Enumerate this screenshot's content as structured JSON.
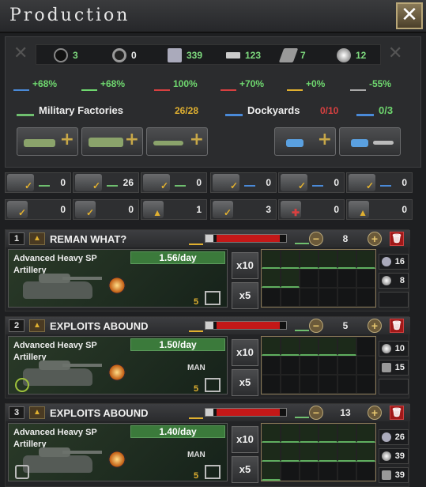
{
  "window": {
    "title": "Production",
    "close_icon": "close-icon"
  },
  "resources": [
    {
      "name": "oil",
      "icon": "oil-drop-icon",
      "value": "3"
    },
    {
      "name": "rubber",
      "icon": "rubber-icon",
      "value": "0"
    },
    {
      "name": "steel",
      "icon": "steel-icon",
      "value": "339"
    },
    {
      "name": "aluminium",
      "icon": "aluminium-icon",
      "value": "123"
    },
    {
      "name": "tungsten",
      "icon": "tungsten-icon",
      "value": "7"
    },
    {
      "name": "chromium",
      "icon": "chromium-icon",
      "value": "12"
    }
  ],
  "modifiers": [
    {
      "icon": "factory-output-icon",
      "value": "+68%"
    },
    {
      "icon": "production-efficiency-icon",
      "value": "+68%"
    },
    {
      "icon": "efficiency-cap-icon",
      "value": "100%"
    },
    {
      "icon": "efficiency-growth-icon",
      "value": "+70%"
    },
    {
      "icon": "efficiency-retention-icon",
      "value": "+0%"
    },
    {
      "icon": "resource-penalty-icon",
      "value": "-55%"
    }
  ],
  "sections": {
    "military": {
      "label": "Military Factories",
      "value": "26/28",
      "value_color": "#e0b030"
    },
    "dockyards": {
      "label": "Dockyards",
      "value": "0/10",
      "value_color": "#d84040",
      "repair_value": "0/3"
    }
  },
  "buttons": {
    "add_land": "+",
    "add_armor": "+",
    "add_air": "+",
    "add_naval": "+",
    "repair": "wrench-icon"
  },
  "summary": [
    {
      "icon": "infantry-equipment-icon",
      "value": "0"
    },
    {
      "icon": "armor-icon",
      "value": "26"
    },
    {
      "icon": "aircraft-icon",
      "value": "0"
    },
    {
      "icon": "naval-icon",
      "value": "0"
    },
    {
      "icon": "anchor-icon",
      "value": "0"
    },
    {
      "icon": "ship-icon",
      "value": "0"
    },
    {
      "icon": "support-icon",
      "value": "0"
    },
    {
      "icon": "fuel-icon",
      "value": "0"
    },
    {
      "icon": "upgrade-icon",
      "value": "1"
    },
    {
      "icon": "convoy-icon",
      "value": "3"
    },
    {
      "icon": "medical-icon",
      "value": "0"
    },
    {
      "icon": "naval-upgrade-icon",
      "value": "0"
    }
  ],
  "lines": [
    {
      "index": "1",
      "name": "REMAN WHAT?",
      "quantity": "8",
      "equipment": "Advanced Heavy SP Artillery",
      "rate": "1.56/day",
      "factories": "5",
      "multipliers": [
        "x10",
        "x5"
      ],
      "man": "",
      "requirements": [
        {
          "icon": "steel-icon",
          "value": "16"
        },
        {
          "icon": "chromium-icon",
          "value": "8"
        }
      ],
      "progress": 0.1
    },
    {
      "index": "2",
      "name": "EXPLOITS ABOUND",
      "quantity": "5",
      "equipment": "Advanced Heavy SP Artillery",
      "rate": "1.50/day",
      "factories": "5",
      "multipliers": [
        "x10",
        "x5"
      ],
      "man": "MAN",
      "requirements": [
        {
          "icon": "chromium-icon",
          "value": "10"
        },
        {
          "icon": "tungsten-icon",
          "value": "15"
        }
      ],
      "progress": 0.1
    },
    {
      "index": "3",
      "name": "EXPLOITS ABOUND",
      "quantity": "13",
      "equipment": "Advanced Heavy SP Artillery",
      "rate": "1.40/day",
      "factories": "5",
      "multipliers": [
        "x10",
        "x5"
      ],
      "man": "MAN",
      "requirements": [
        {
          "icon": "steel-icon",
          "value": "26"
        },
        {
          "icon": "chromium-icon",
          "value": "39"
        },
        {
          "icon": "tungsten-icon",
          "value": "39"
        }
      ],
      "progress": 0.1
    }
  ],
  "colors": {
    "accent": "#e0b030",
    "positive": "#6fd86f",
    "negative": "#d84040",
    "rate_bg": "#3b7a3b"
  }
}
